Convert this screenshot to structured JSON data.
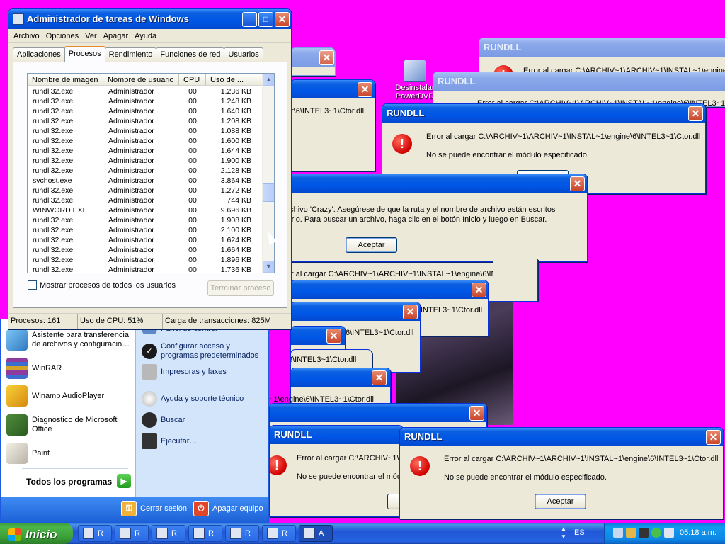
{
  "desktop": {
    "icon_label_1": "Desinstalar",
    "icon_label_2": "PowerDVD"
  },
  "rundll_title": "RUNDLL",
  "error_lines": {
    "full_path": "Error al cargar C:\\ARCHIV~1\\ARCHIV~1\\INSTAL~1\\engine\\6\\INTEL3~1\\Ctor.dll",
    "full_path_b": "Error al cargar C:\\ARCHIV~1\\ARCHIV~1\\INSTAL~1\\engine",
    "partial_ctor": "r\\6\\INTEL3~1\\Ctor.dll",
    "partial_path2": "r al cargar C:\\ARCHIV~1\\ARCHIV~1\\INSTAL~1\\engine\\6\\INTEL3~1\\Ctor.dll",
    "partial_intel": "INTEL3~1\\Ctor.dll",
    "partial_6intel": "6\\INTEL3~1\\Ctor.dll",
    "partial_engine": "~1\\engine\\6\\INTEL3~1\\Ctor.dll",
    "partial_top": "Error al cargar C:\\ARCHIV~1\\ARCHIV~1\\INSTAL~1\\engine\\6\\INTEL3~1\\",
    "module_missing": "No se puede encontrar el módulo especificado.",
    "module_missing_cut": "No se puede encontrar el módu",
    "error_short": "Error al cargar C:\\ARCHIV~1\\ARCHIV~1\\INSTAL~1\\engine\\6\\INTEL3~1\\Ctor.dll"
  },
  "crazy_dialog": {
    "line1": "r el archivo 'Crazy'. Asegúrese de que la ruta y el nombre de archivo están escritos",
    "line2": "ntentarlo. Para buscar un archivo, haga clic en el botón Inicio y luego en Buscar.",
    "ok": "Aceptar"
  },
  "ok_label": "Aceptar",
  "task_manager": {
    "title": "Administrador de tareas de Windows",
    "menu": [
      "Archivo",
      "Opciones",
      "Ver",
      "Apagar",
      "Ayuda"
    ],
    "tabs": [
      "Aplicaciones",
      "Procesos",
      "Rendimiento",
      "Funciones de red",
      "Usuarios"
    ],
    "columns": [
      "Nombre de imagen",
      "Nombre de usuario",
      "CPU",
      "Uso de ..."
    ],
    "rows": [
      [
        "rundll32.exe",
        "Administrador",
        "00",
        "1.236 KB"
      ],
      [
        "rundll32.exe",
        "Administrador",
        "00",
        "1.248 KB"
      ],
      [
        "rundll32.exe",
        "Administrador",
        "00",
        "1.640 KB"
      ],
      [
        "rundll32.exe",
        "Administrador",
        "00",
        "1.208 KB"
      ],
      [
        "rundll32.exe",
        "Administrador",
        "00",
        "1.088 KB"
      ],
      [
        "rundll32.exe",
        "Administrador",
        "00",
        "1.600 KB"
      ],
      [
        "rundll32.exe",
        "Administrador",
        "00",
        "1.644 KB"
      ],
      [
        "rundll32.exe",
        "Administrador",
        "00",
        "1.900 KB"
      ],
      [
        "rundll32.exe",
        "Administrador",
        "00",
        "2.128 KB"
      ],
      [
        "svchost.exe",
        "Administrador",
        "00",
        "3.864 KB"
      ],
      [
        "rundll32.exe",
        "Administrador",
        "00",
        "1.272 KB"
      ],
      [
        "rundll32.exe",
        "Administrador",
        "00",
        "744 KB"
      ],
      [
        "WINWORD.EXE",
        "Administrador",
        "00",
        "9.696 KB"
      ],
      [
        "rundll32.exe",
        "Administrador",
        "00",
        "1.908 KB"
      ],
      [
        "rundll32.exe",
        "Administrador",
        "00",
        "2.100 KB"
      ],
      [
        "rundll32.exe",
        "Administrador",
        "00",
        "1.624 KB"
      ],
      [
        "rundll32.exe",
        "Administrador",
        "00",
        "1.664 KB"
      ],
      [
        "rundll32.exe",
        "Administrador",
        "00",
        "1.896 KB"
      ],
      [
        "rundll32.exe",
        "Administrador",
        "00",
        "1.736 KB"
      ]
    ],
    "show_all_label": "Mostrar procesos de todos los usuarios",
    "end_process_label": "Terminar proceso",
    "status": {
      "processes": "Procesos: 161",
      "cpu": "Uso de CPU: 51%",
      "commit": "Carga de transacciones: 825M"
    }
  },
  "start_menu": {
    "left_items": [
      "Asistente para transferencia de archivos y configuracio…",
      "WinRAR",
      "Winamp AudioPlayer",
      "Diagnostico de Microsoft Office",
      "Paint"
    ],
    "all_programs": "Todos los programas",
    "right_items": [
      "Panel de control",
      "Configurar acceso y programas predeterminados",
      "Impresoras y faxes",
      "Ayuda y soporte técnico",
      "Buscar",
      "Ejecutar…"
    ],
    "logoff": "Cerrar sesión",
    "shutdown": "Apagar equipo"
  },
  "taskbar": {
    "start_label": "Inicio",
    "buttons": [
      "R",
      "R",
      "R",
      "R",
      "R",
      "R",
      "A"
    ],
    "language": "ES",
    "clock": "05:18 a.m."
  },
  "colors": {
    "desktop_bg": "#ff00ff",
    "title_active": "#0a5fe0",
    "title_inactive": "#7b9be4",
    "start_green": "#3b9e38"
  }
}
